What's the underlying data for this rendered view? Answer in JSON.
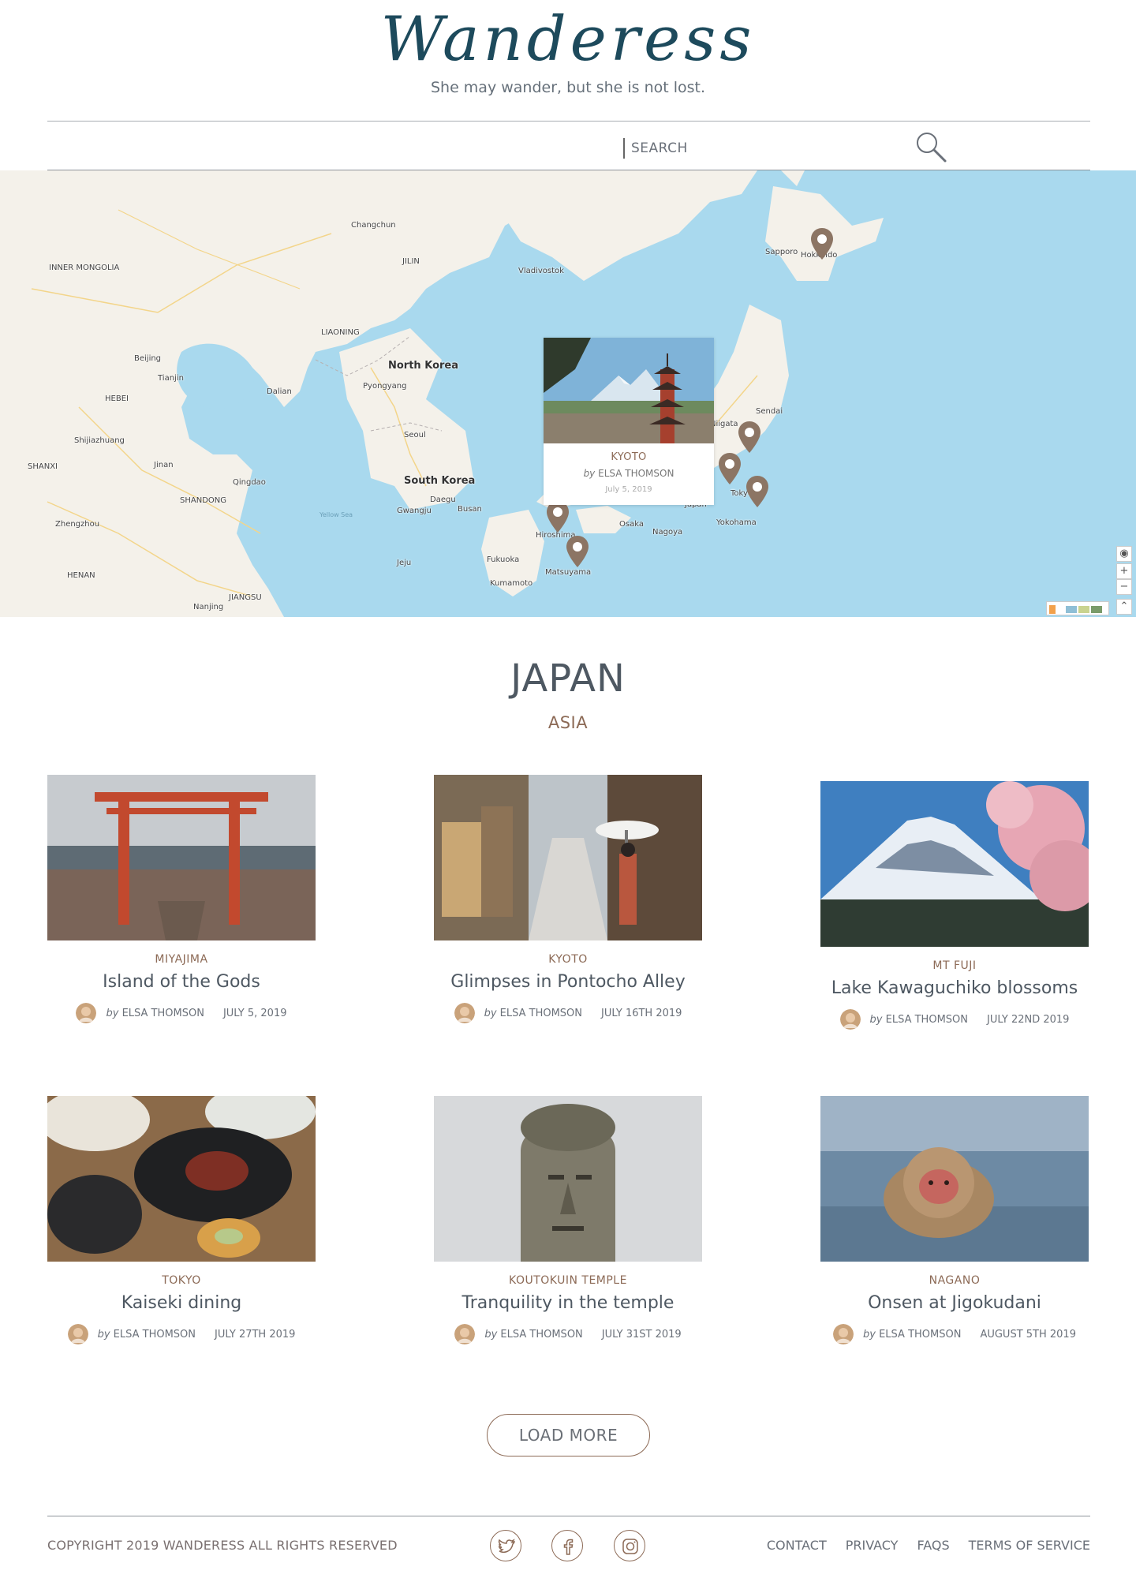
{
  "header": {
    "logo": "Wanderess",
    "tagline": "She may wander, but she is not lost.",
    "search_placeholder": "SEARCH"
  },
  "map": {
    "labels": {
      "inner_mongolia": "INNER MONGOLIA",
      "changchun": "Changchun",
      "jilin": "JILIN",
      "liaoning": "LIAONING",
      "north_korea": "North Korea",
      "pyongyang": "Pyongyang",
      "dalian": "Dalian",
      "beijing": "Beijing",
      "tianjin": "Tianjin",
      "hebei": "HEBEI",
      "shijiazhuang": "Shijiazhuang",
      "shanxi": "SHANXI",
      "jinan": "Jinan",
      "shandong": "SHANDONG",
      "qingdao": "Qingdao",
      "zhengzhou": "Zhengzhou",
      "henan": "HENAN",
      "jiangsu": "JIANGSU",
      "nanjing": "Nanjing",
      "seoul": "Seoul",
      "south_korea": "South Korea",
      "daegu": "Daegu",
      "busan": "Busan",
      "gwangju": "Gwangju",
      "jeju": "Jeju",
      "yellow_sea": "Yellow Sea",
      "vladivostok": "Vladivostok",
      "sapporo": "Sapporo",
      "hokkaido": "Hokkaido",
      "sendai": "Sendai",
      "niigata": "Niigata",
      "tokyo": "Tokyo",
      "yokohama": "Yokohama",
      "nagoya": "Nagoya",
      "osaka": "Osaka",
      "hiroshima": "Hiroshima",
      "fukuoka": "Fukuoka",
      "kumamoto": "Kumamoto",
      "matsuyama": "Matsuyama",
      "japan": "Japan"
    },
    "popup": {
      "location": "KYOTO",
      "by_prefix": "by",
      "author": "ELSA THOMSON",
      "date": "July 5, 2019"
    },
    "controls": {
      "locate": "◉",
      "zoom_in": "+",
      "zoom_out": "−",
      "expand": "⌃"
    }
  },
  "section": {
    "title": "JAPAN",
    "subtitle": "ASIA"
  },
  "cards": [
    {
      "location": "MIYAJIMA",
      "title": "Island of the Gods",
      "by_prefix": "by",
      "author": "ELSA THOMSON",
      "date": "JULY 5, 2019"
    },
    {
      "location": "KYOTO",
      "title": "Glimpses in Pontocho Alley",
      "by_prefix": "by",
      "author": "ELSA THOMSON",
      "date": "JULY 16TH 2019"
    },
    {
      "location": "MT FUJI",
      "title": "Lake Kawaguchiko blossoms",
      "by_prefix": "by",
      "author": "ELSA THOMSON",
      "date": "JULY 22ND 2019"
    },
    {
      "location": "TOKYO",
      "title": "Kaiseki dining",
      "by_prefix": "by",
      "author": "ELSA THOMSON",
      "date": "JULY 27TH 2019"
    },
    {
      "location": "KOUTOKUIN TEMPLE",
      "title": "Tranquility in the temple",
      "by_prefix": "by",
      "author": "ELSA THOMSON",
      "date": "JULY 31ST 2019"
    },
    {
      "location": "NAGANO",
      "title": "Onsen at Jigokudani",
      "by_prefix": "by",
      "author": "ELSA THOMSON",
      "date": "AUGUST 5TH 2019"
    }
  ],
  "load_more": "LOAD MORE",
  "footer": {
    "copyright": "COPYRIGHT 2019 WANDERESS ALL RIGHTS RESERVED",
    "social": [
      "twitter-icon",
      "facebook-icon",
      "instagram-icon"
    ],
    "links": [
      "CONTACT",
      "PRIVACY",
      "FAQS",
      "TERMS OF SERVICE"
    ]
  },
  "colors": {
    "accent": "#8c6a56",
    "heading": "#4e5862",
    "logo": "#1d4a5c",
    "water": "#a9d9ee",
    "land": "#f4f1ea"
  }
}
